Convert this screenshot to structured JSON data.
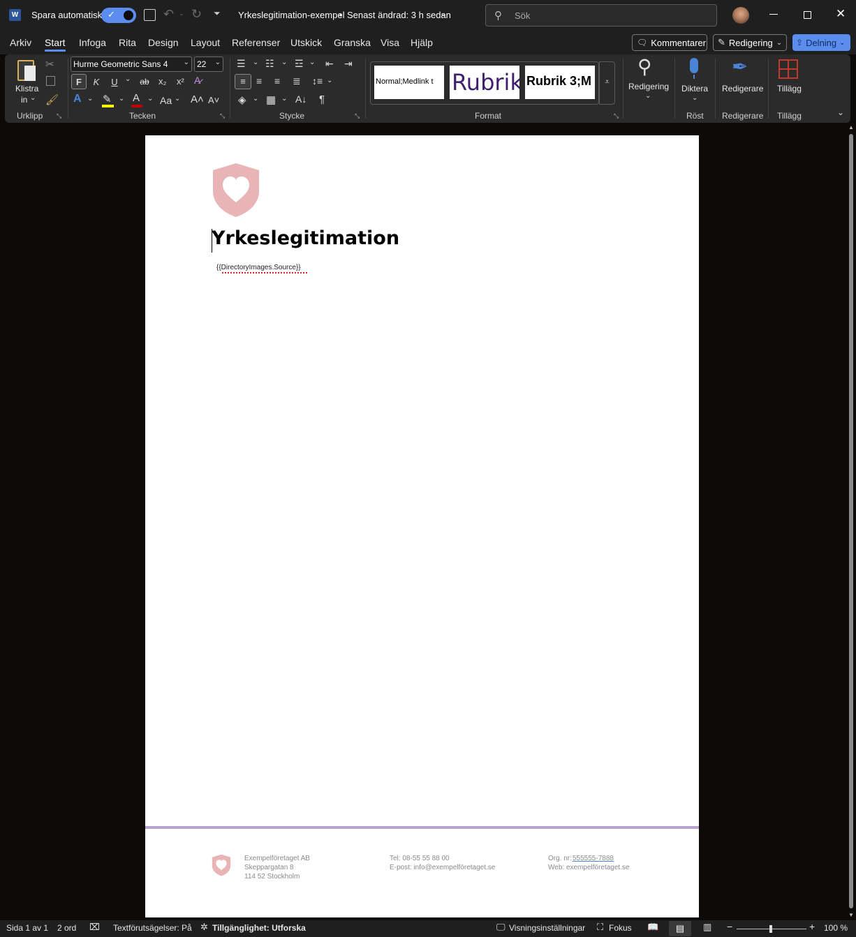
{
  "titlebar": {
    "app_icon": "word-icon",
    "autosave_label": "Spara automatiskt",
    "doc_title": "Yrkeslegitimation-exempel",
    "separator": "•",
    "modified": "Senast ändrad: 3 h sedan",
    "search_placeholder": "Sök"
  },
  "menu": {
    "items": [
      "Arkiv",
      "Start",
      "Infoga",
      "Rita",
      "Design",
      "Layout",
      "Referenser",
      "Utskick",
      "Granska",
      "Visa",
      "Hjälp"
    ],
    "active": "Start",
    "comments_label": "Kommentarer",
    "editing_label": "Redigering",
    "share_label": "Delning"
  },
  "ribbon": {
    "paste_label_1": "Klistra",
    "paste_label_2": "in",
    "clipboard_group": "Urklipp",
    "font_name": "Hurme Geometric Sans 4",
    "font_size": "22",
    "bold": "F",
    "italic": "K",
    "underline": "U",
    "strike": "ab",
    "font_group": "Tecken",
    "case_label": "Aa",
    "paragraph_group": "Stycke",
    "styles": [
      "Normal;Medlink t",
      "Rubrik",
      "Rubrik 3;M"
    ],
    "styles_group": "Format",
    "editing_btn": "Redigering",
    "dictate_btn": "Diktera",
    "voice_group": "Röst",
    "editor_btn": "Redigerare",
    "editor_group": "Redigerare",
    "addins_btn": "Tillägg",
    "addins_group": "Tillägg",
    "accent_color": "#4a84d6",
    "title_color": "#3d1f6e"
  },
  "document": {
    "heading": "Yrkeslegitimation",
    "placeholder": "{{DirectoryImages.Source}}",
    "footer": {
      "company": "Exempelföretaget AB",
      "street": "Skeppargatan 8",
      "city": "114 52 Stockholm",
      "phone": "Tel: 08-55 55 88 00",
      "email": "E-post: info@exempelföretaget.se",
      "org_label": "Org. nr:",
      "org_number": "555555-7888",
      "web": "Web: exempelföretaget.se"
    },
    "logo_color": "#e8b4b6",
    "footer_rule_color": "#b9a2cc"
  },
  "status": {
    "page": "Sida 1 av 1",
    "words": "2 ord",
    "predictions": "Textförutsägelser: På",
    "accessibility": "Tillgänglighet: Utforska",
    "view_settings": "Visningsinställningar",
    "focus": "Fokus",
    "zoom": "100 %"
  }
}
